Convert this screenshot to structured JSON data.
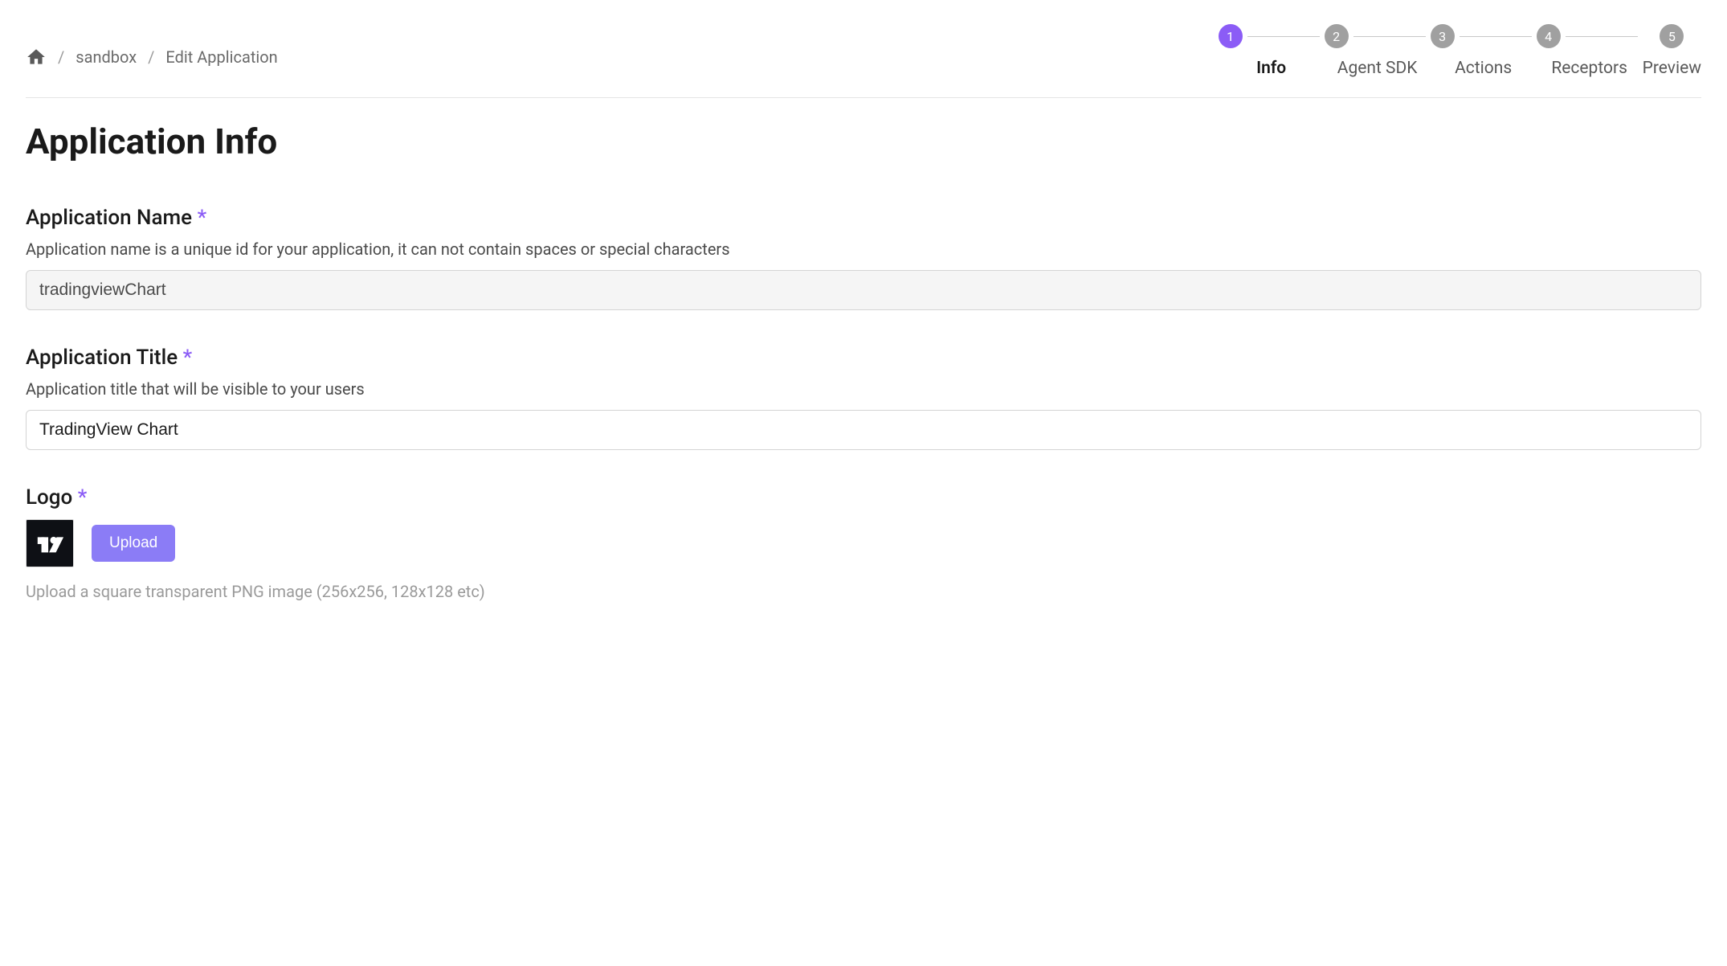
{
  "breadcrumb": {
    "home_icon": "home-icon",
    "items": [
      {
        "label": "sandbox"
      },
      {
        "label": "Edit Application"
      }
    ]
  },
  "stepper": {
    "steps": [
      {
        "number": "1",
        "label": "Info",
        "active": true
      },
      {
        "number": "2",
        "label": "Agent SDK",
        "active": false
      },
      {
        "number": "3",
        "label": "Actions",
        "active": false
      },
      {
        "number": "4",
        "label": "Receptors",
        "active": false
      },
      {
        "number": "5",
        "label": "Preview",
        "active": false
      }
    ]
  },
  "page": {
    "title": "Application Info"
  },
  "fields": {
    "name": {
      "label": "Application Name",
      "required_mark": "*",
      "help": "Application name is a unique id for your application, it can not contain spaces or special characters",
      "value": "tradingviewChart"
    },
    "title": {
      "label": "Application Title",
      "required_mark": "*",
      "help": "Application title that will be visible to your users",
      "value": "TradingView Chart"
    },
    "logo": {
      "label": "Logo",
      "required_mark": "*",
      "upload_label": "Upload",
      "help": "Upload a square transparent PNG image (256x256, 128x128 etc)"
    }
  }
}
